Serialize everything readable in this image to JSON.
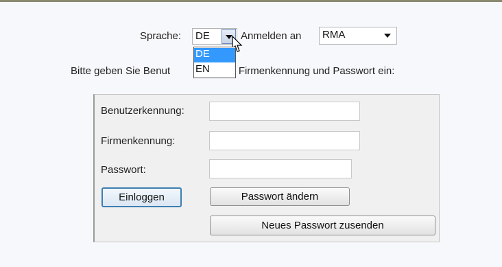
{
  "language_row": {
    "language_label": "Sprache:",
    "language_value": "DE",
    "login_at_label": "Anmelden an",
    "login_at_value": "RMA",
    "language_options": [
      "DE",
      "EN"
    ]
  },
  "prompt_text": "Bitte geben Sie Benut",
  "prompt_text_tail": "nung, Firmenkennung und Passwort ein:",
  "form": {
    "username_label": "Benutzerkennung:",
    "company_label": "Firmenkennung:",
    "password_label": "Passwort:",
    "username_value": "",
    "company_value": "",
    "password_value": ""
  },
  "buttons": {
    "login": "Einloggen",
    "change_password": "Passwort ändern",
    "send_new_password": "Neues Passwort zusenden"
  },
  "colors": {
    "highlight": "#3399ff",
    "primary_button_border": "#3c7fb1"
  }
}
